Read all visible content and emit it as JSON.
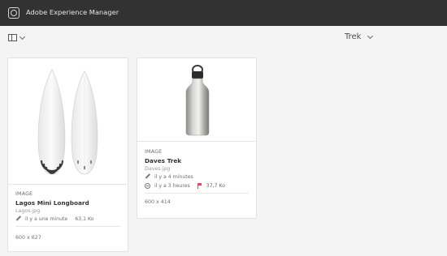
{
  "app": {
    "title": "Adobe Experience Manager"
  },
  "toolbar": {
    "view_label": "Trek"
  },
  "cards": [
    {
      "type": "IMAGE",
      "title": "Lagos Mini Longboard",
      "filename": "Lagos.jpg",
      "modified": "il y a une minute",
      "size": "63,1 Ko",
      "dimensions": "600 x 627"
    },
    {
      "type": "IMAGE",
      "title": "Daves Trek",
      "filename": "Daves.jpg",
      "modified": "il y a 4 minutes",
      "published": "il y a 3 heures",
      "size": "37,7 Ko",
      "dimensions": "600 x 414"
    }
  ],
  "colors": {
    "header": "#323232",
    "background": "#f4f4f4",
    "flag": "#e34850"
  }
}
